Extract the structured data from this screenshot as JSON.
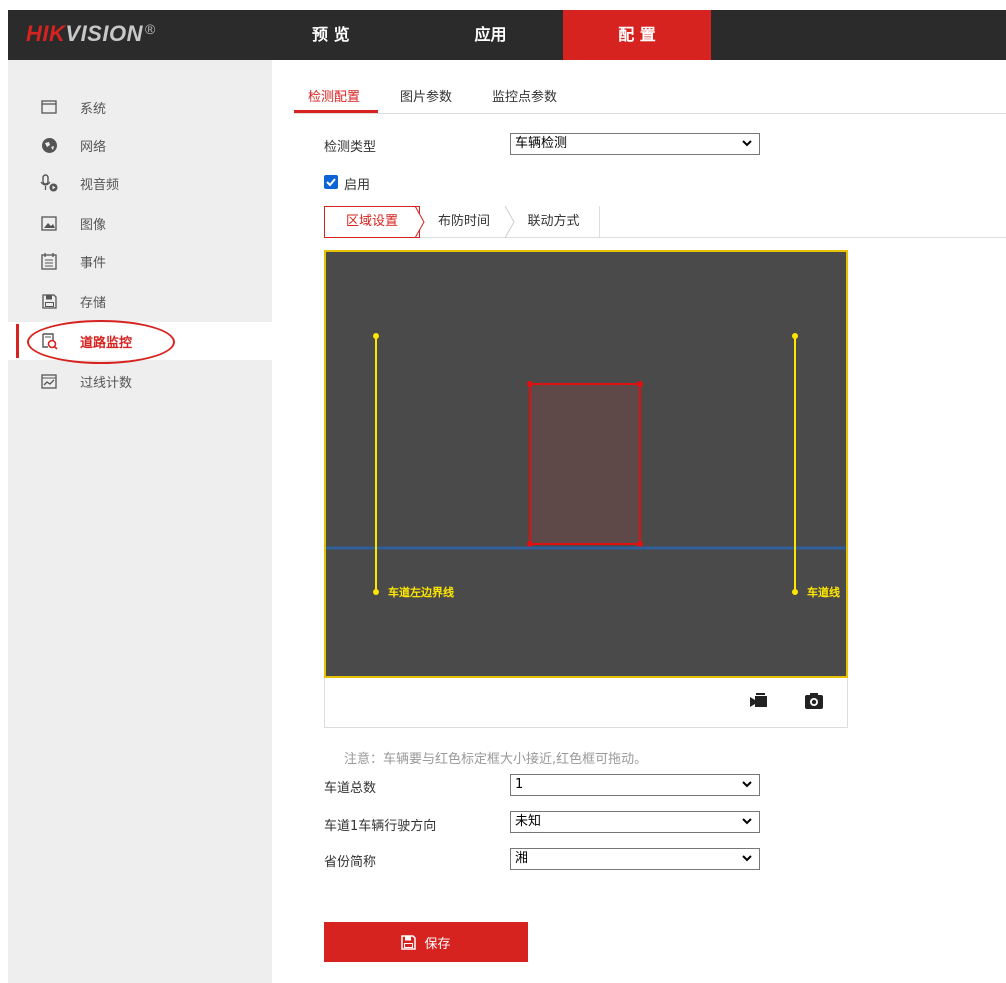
{
  "brand": {
    "logo_red": "HIK",
    "logo_gray": "VISION",
    "reg": "®"
  },
  "nav": {
    "preview": "预 览",
    "apps": "应用",
    "config": "配 置"
  },
  "sidebar": {
    "items": [
      {
        "label": "系统",
        "icon": "monitor-icon"
      },
      {
        "label": "网络",
        "icon": "globe-icon"
      },
      {
        "label": "视音频",
        "icon": "mic-video-icon"
      },
      {
        "label": "图像",
        "icon": "image-icon"
      },
      {
        "label": "事件",
        "icon": "calendar-icon"
      },
      {
        "label": "存储",
        "icon": "save-disk-icon"
      },
      {
        "label": "道路监控",
        "icon": "road-monitor-icon",
        "active": true
      },
      {
        "label": "过线计数",
        "icon": "chart-icon"
      }
    ]
  },
  "tabs": {
    "detect_config": "检测配置",
    "picture_params": "图片参数",
    "monitor_point_params": "监控点参数"
  },
  "detect_type": {
    "label": "检测类型",
    "value": "车辆检测"
  },
  "enable": {
    "label": "启用",
    "checked": true
  },
  "subtabs": {
    "area": "区域设置",
    "arming_time": "布防时间",
    "linkage": "联动方式"
  },
  "video": {
    "left_lane_label": "车道左边界线",
    "right_lane_label": "车道线"
  },
  "note": "注意：车辆要与红色标定框大小接近,红色框可拖动。",
  "lane_total": {
    "label": "车道总数",
    "value": "1"
  },
  "lane1_direction": {
    "label": "车道1车辆行驶方向",
    "value": "未知"
  },
  "province": {
    "label": "省份简称",
    "value": "湘"
  },
  "save_label": "保存",
  "colors": {
    "accent": "#d6231f",
    "topbar": "#2b2b2b",
    "sidebar": "#eeeeee",
    "lane_line": "#ffe600",
    "trigger_line": "#2f5f9a"
  }
}
